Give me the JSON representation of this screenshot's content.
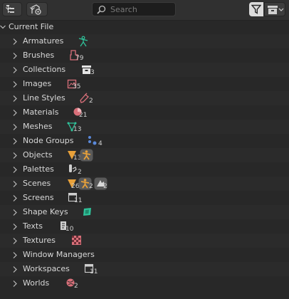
{
  "header": {
    "search_placeholder": "Search"
  },
  "root": {
    "label": "Current File"
  },
  "items": [
    {
      "label": "Armatures",
      "count": ""
    },
    {
      "label": "Brushes",
      "count": "79"
    },
    {
      "label": "Collections",
      "count": "3"
    },
    {
      "label": "Images",
      "count": "35"
    },
    {
      "label": "Line Styles",
      "count": "2"
    },
    {
      "label": "Materials",
      "count": "21"
    },
    {
      "label": "Meshes",
      "count": "13"
    },
    {
      "label": "Node Groups",
      "count": "4"
    },
    {
      "label": "Objects",
      "count": "13"
    },
    {
      "label": "Palettes",
      "count": "2"
    },
    {
      "label": "Scenes",
      "count": "26",
      "count2": "2",
      "count3": "2"
    },
    {
      "label": "Screens",
      "count": "11"
    },
    {
      "label": "Shape Keys",
      "count": ""
    },
    {
      "label": "Texts",
      "count": "10"
    },
    {
      "label": "Textures",
      "count": ""
    },
    {
      "label": "Window Managers",
      "count": ""
    },
    {
      "label": "Workspaces",
      "count": "11"
    },
    {
      "label": "Worlds",
      "count": "2"
    }
  ],
  "colors": {
    "background": "#282828",
    "header": "#303030",
    "accent_orange": "#e8a13a",
    "mesh_green": "#2fc29a",
    "data_red": "#d9707a",
    "node_blue": "#5a88d8"
  }
}
